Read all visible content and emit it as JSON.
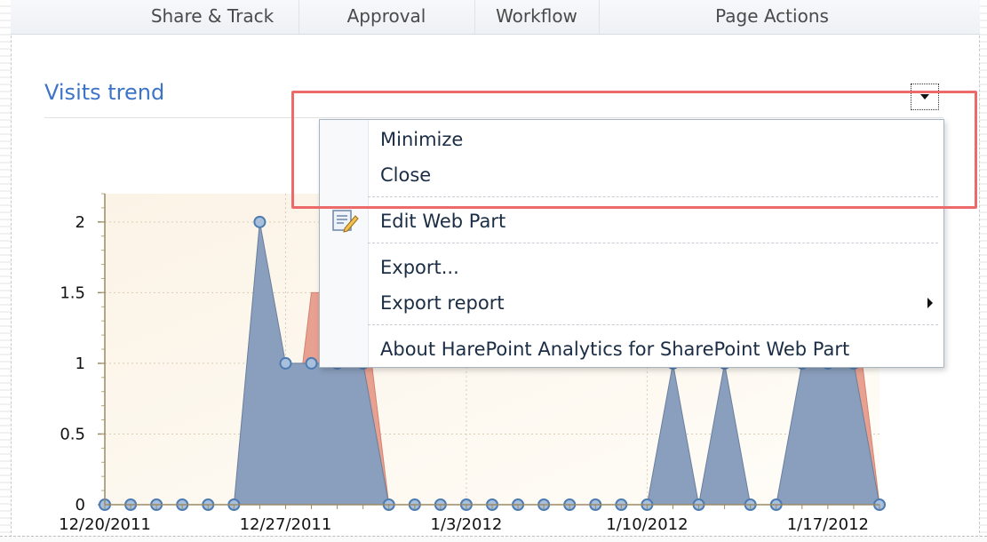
{
  "ribbon": {
    "groups": [
      "Share & Track",
      "Approval",
      "Workflow",
      "Page Actions"
    ]
  },
  "webpart": {
    "title": "Visits trend",
    "menu_button_icon": "dropdown-arrow-icon"
  },
  "menu": {
    "items": [
      {
        "label": "Minimize"
      },
      {
        "label": "Close"
      },
      {
        "label": "Edit Web Part",
        "icon": "edit-webpart-icon"
      },
      {
        "label": "Export..."
      },
      {
        "label": "Export report",
        "has_submenu": true
      },
      {
        "label": "About HarePoint Analytics for SharePoint Web Part"
      }
    ],
    "highlight_color": "#ec6a6a"
  },
  "chart_data": {
    "type": "area",
    "title": "",
    "xlabel": "",
    "ylabel": "",
    "x": [
      "12/20/2011",
      "12/21/2011",
      "12/22/2011",
      "12/23/2011",
      "12/24/2011",
      "12/25/2011",
      "12/26/2011",
      "12/27/2011",
      "12/28/2011",
      "12/29/2011",
      "12/30/2011",
      "12/31/2011",
      "1/1/2012",
      "1/2/2012",
      "1/3/2012",
      "1/4/2012",
      "1/5/2012",
      "1/6/2012",
      "1/7/2012",
      "1/8/2012",
      "1/9/2012",
      "1/10/2012",
      "1/11/2012",
      "1/12/2012",
      "1/13/2012",
      "1/14/2012",
      "1/15/2012",
      "1/16/2012",
      "1/17/2012",
      "1/18/2012",
      "1/19/2012"
    ],
    "x_tick_labels": [
      "12/20/2011",
      "12/27/2011",
      "1/3/2012",
      "1/10/2012",
      "1/17/2012"
    ],
    "y_tick_labels": [
      "0",
      "0.5",
      "1",
      "1.5",
      "2"
    ],
    "ylim": [
      0,
      2.2
    ],
    "series": [
      {
        "color": "#e8a090",
        "values": [
          0,
          0,
          0,
          0,
          0,
          0,
          0,
          0,
          1.5,
          1.5,
          1.5,
          0,
          0,
          0,
          0,
          0,
          0,
          0,
          0,
          0,
          0,
          0,
          0,
          0,
          0,
          0,
          0,
          0,
          0,
          1.5,
          0
        ]
      },
      {
        "color": "#8a9fbd",
        "values": [
          0,
          0,
          0,
          0,
          0,
          0,
          2,
          1,
          1,
          1,
          1,
          0,
          0,
          0,
          0,
          0,
          0,
          0,
          0,
          0,
          0,
          0,
          1,
          0,
          1,
          0,
          0,
          1,
          1,
          1,
          0
        ]
      }
    ],
    "colors": {
      "plot_bg": "#fdf6ea",
      "marker_fill": "#a9c0dc",
      "marker_stroke": "#4e7bb1",
      "area_stroke": "#6a7f9c"
    },
    "grid": true
  }
}
